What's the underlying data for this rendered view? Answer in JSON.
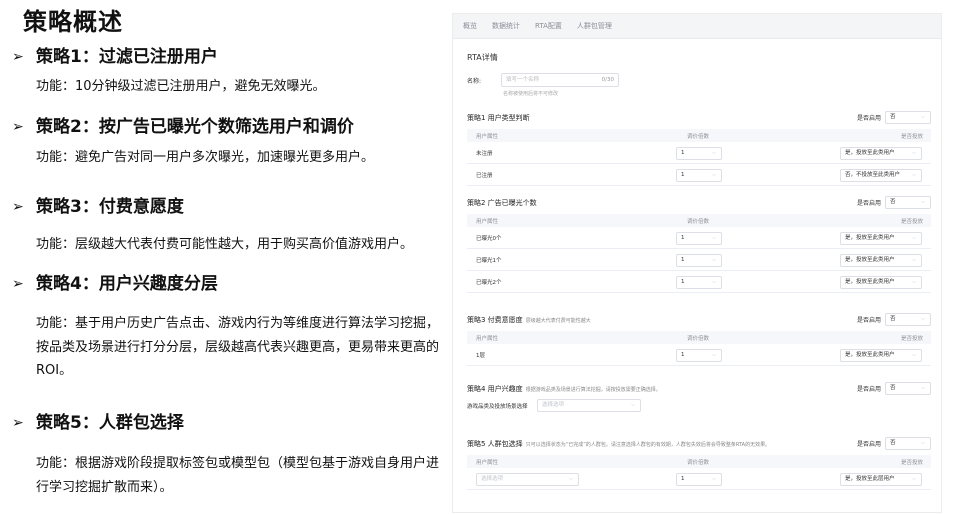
{
  "slide": {
    "title": "策略概述",
    "strategies": [
      {
        "heading": "策略1：过滤已注册用户",
        "desc": "功能：10分钟级过滤已注册用户，避免无效曝光。"
      },
      {
        "heading": "策略2：按广告已曝光个数筛选用户和调价",
        "desc": "功能：避免广告对同一用户多次曝光，加速曝光更多用户。"
      },
      {
        "heading": "策略3：付费意愿度",
        "desc": "功能：层级越大代表付费可能性越大，用于购买高价值游戏用户。"
      },
      {
        "heading": "策略4：用户兴趣度分层",
        "desc": "功能：基于用户历史广告点击、游戏内行为等维度进行算法学习挖掘，按品类及场景进行打分分层，层级越高代表兴趣更高，更易带来更高的ROI。"
      },
      {
        "heading": "策略5：人群包选择",
        "desc": "功能：根据游戏阶段提取标签包或模型包（模型包基于游戏自身用户进行学习挖掘扩散而来）。"
      }
    ]
  },
  "panel": {
    "nav": [
      "概览",
      "数据统计",
      "RTA配置",
      "人群包管理"
    ],
    "card_title": "RTA详情",
    "name_label": "名称:",
    "name_placeholder": "填写一个名称",
    "name_count": "0/30",
    "name_hint": "名称被使用后将不可修改",
    "enable_label": "是否启用",
    "enable_value": "否",
    "columns": {
      "attr": "用户属性",
      "weight": "调价倍数",
      "deliver": "是否投放"
    },
    "sec1": {
      "title": "策略1 用户类型判断",
      "rows": [
        {
          "label": "未注册",
          "weight": "1",
          "deliver": "是，投放至此类用户"
        },
        {
          "label": "已注册",
          "weight": "1",
          "deliver": "否，不投放至此类用户"
        }
      ]
    },
    "sec2": {
      "title": "策略2 广告已曝光个数",
      "rows": [
        {
          "label": "已曝光0个",
          "weight": "1",
          "deliver": "是，投放至此类用户"
        },
        {
          "label": "已曝光1个",
          "weight": "1",
          "deliver": "是，投放至此类用户"
        },
        {
          "label": "已曝光2个",
          "weight": "1",
          "deliver": "是，投放至此类用户"
        }
      ]
    },
    "sec3": {
      "title": "策略3 付费意愿度",
      "subtitle": "层级越大代表付费可能性越大",
      "rows": [
        {
          "label": "1层",
          "weight": "1",
          "deliver": "是，投放至此类用户"
        }
      ]
    },
    "sec4": {
      "title": "策略4 用户兴趣度",
      "subtitle": "根据游戏品类及场景进行算法挖掘，请按投放需要正确选择。",
      "field_label": "游戏品类及投放场景选择",
      "field_placeholder": "选择选项"
    },
    "sec5": {
      "title": "策略5 人群包选择",
      "subtitle": "只可以选择状态为“已完成”的人群包。请注意选择人群包的有效期，人群包失效后将会导致整条RTA的无效果。",
      "row": {
        "placeholder": "选择选项",
        "weight": "1",
        "deliver": "是，投放至此层用户"
      }
    }
  }
}
